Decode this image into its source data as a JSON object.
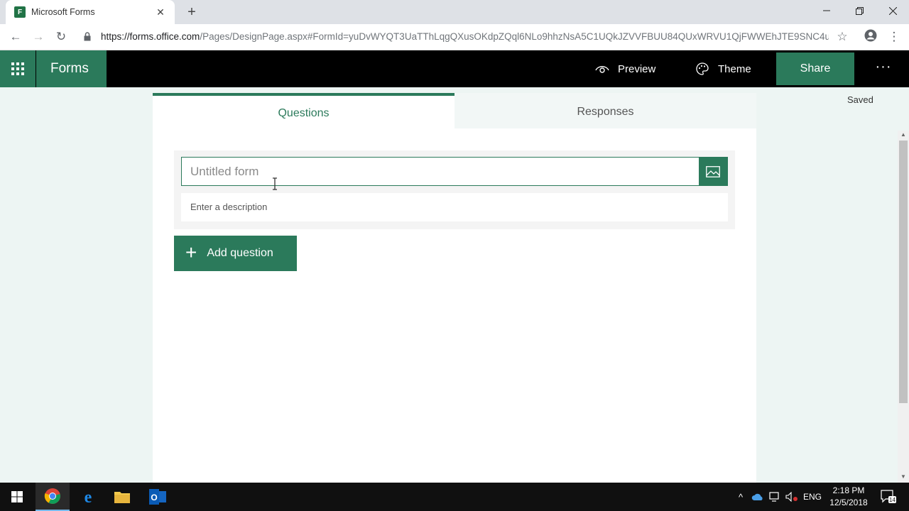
{
  "browser": {
    "tab_title": "Microsoft Forms",
    "favicon_text": "F",
    "url_host": "https://forms.office.com",
    "url_path": "/Pages/DesignPage.aspx#FormId=yuDvWYQT3UaTThLqgQXusOKdpZQql6NLo9hhzNsA5C1UQkJZVVFBUU84QUxWRVU1QjFWWEhJTE9SNC4u"
  },
  "header": {
    "app_name": "Forms",
    "preview_label": "Preview",
    "theme_label": "Theme",
    "share_label": "Share",
    "more_label": "···",
    "brand_color": "#2b7a5b"
  },
  "status": {
    "saved_label": "Saved"
  },
  "tabs": {
    "questions_label": "Questions",
    "responses_label": "Responses"
  },
  "form": {
    "title_placeholder": "Untitled form",
    "description_placeholder": "Enter a description",
    "add_question_label": "Add question"
  },
  "taskbar": {
    "language": "ENG",
    "time": "2:18 PM",
    "date": "12/5/2018",
    "notifications_count": "14"
  }
}
